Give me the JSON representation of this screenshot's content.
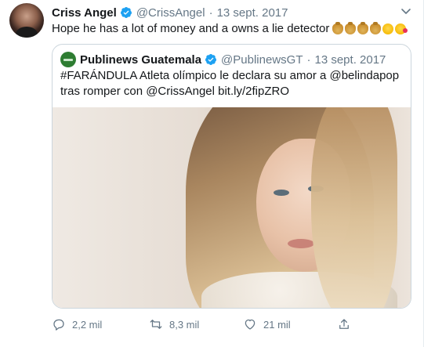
{
  "tweet": {
    "author_name": "Criss Angel",
    "author_handle": "@CrissAngel",
    "separator": "·",
    "date": "13 sept. 2017",
    "text": "Hope he has a lot of money and a owns a lie detector",
    "emojis": [
      "money-bag",
      "money-bag",
      "money-bag",
      "money-bag",
      "tears-of-joy",
      "face-blowing-kiss"
    ],
    "quoted": {
      "author_name": "Publinews Guatemala",
      "author_handle": "@PublinewsGT",
      "separator": "·",
      "date": "13 sept. 2017",
      "text": "#FARÁNDULA Atleta olímpico le declara su amor a @belindapop tras romper con @CrissAngel bit.ly/2fipZRO"
    },
    "actions": {
      "reply_count": "2,2 mil",
      "retweet_count": "8,3 mil",
      "like_count": "21 mil"
    }
  },
  "colors": {
    "verified": "#1da1f2",
    "secondary_text": "#657786",
    "border": "#ccd6dd",
    "publinews_green": "#2e7d32"
  }
}
